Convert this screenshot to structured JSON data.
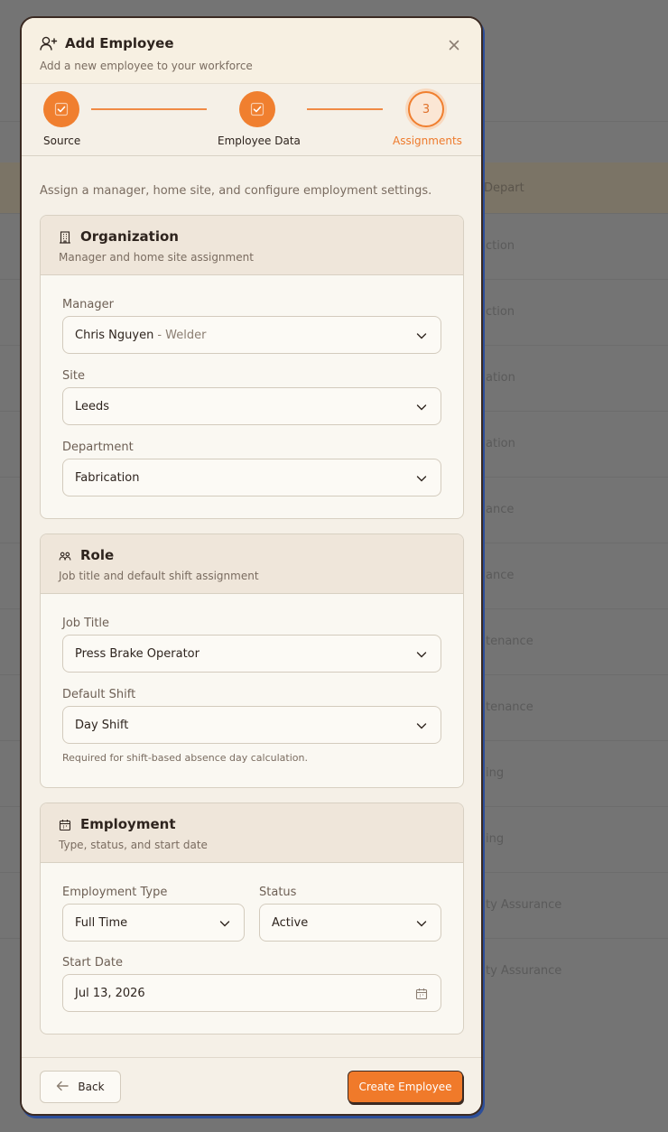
{
  "background": {
    "header_text": "Depart",
    "rows": [
      "ction",
      "ction",
      "ation",
      "ation",
      "ance",
      "ance",
      "tenance",
      "tenance",
      "ing",
      "ing",
      "ty Assurance",
      "ty Assurance"
    ]
  },
  "modal": {
    "title": "Add Employee",
    "subtitle": "Add a new employee to your workforce",
    "steps": [
      {
        "label": "Source",
        "state": "done"
      },
      {
        "label": "Employee Data",
        "state": "done"
      },
      {
        "label": "Assignments",
        "number": "3",
        "state": "active"
      }
    ],
    "intro": "Assign a manager, home site, and configure employment settings.",
    "organization": {
      "title": "Organization",
      "subtitle": "Manager and home site assignment",
      "manager_label": "Manager",
      "manager_value": "Chris Nguyen",
      "manager_role": "- Welder",
      "site_label": "Site",
      "site_value": "Leeds",
      "department_label": "Department",
      "department_value": "Fabrication"
    },
    "role": {
      "title": "Role",
      "subtitle": "Job title and default shift assignment",
      "job_title_label": "Job Title",
      "job_title_value": "Press Brake Operator",
      "shift_label": "Default Shift",
      "shift_value": "Day Shift",
      "shift_help": "Required for shift-based absence day calculation."
    },
    "employment": {
      "title": "Employment",
      "subtitle": "Type, status, and start date",
      "type_label": "Employment Type",
      "type_value": "Full Time",
      "status_label": "Status",
      "status_value": "Active",
      "start_label": "Start Date",
      "start_value": "Jul 13, 2026"
    },
    "footer": {
      "back_label": "Back",
      "create_label": "Create Employee"
    }
  },
  "colors": {
    "accent": "#f07a2a",
    "modal_bg": "#f5f0e7",
    "card_head": "#efe6da",
    "overlay": "#747474"
  }
}
